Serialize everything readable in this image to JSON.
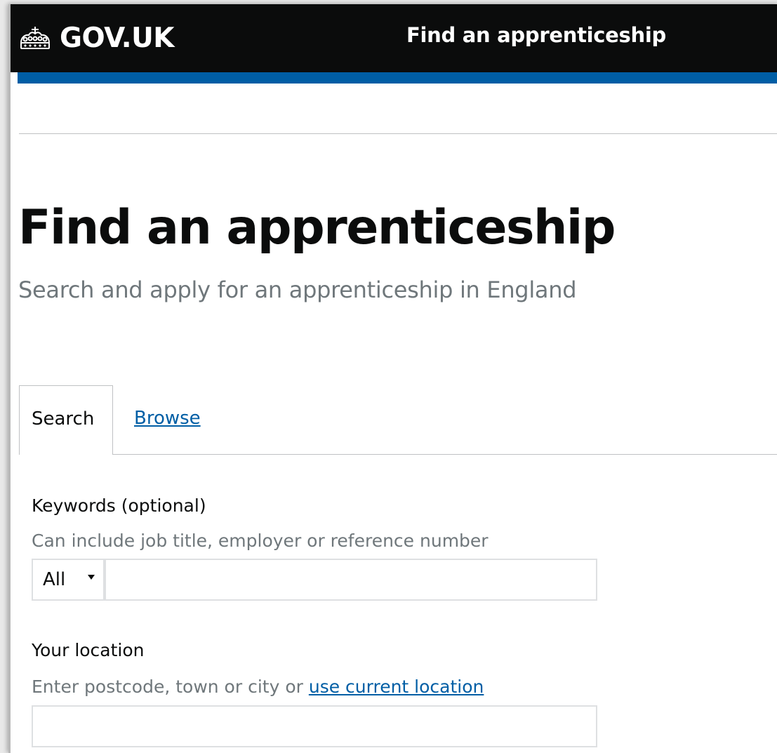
{
  "header": {
    "logo_text": "GOV.UK",
    "logo_icon": "crown-icon",
    "service_name": "Find an apprenticeship",
    "colors": {
      "header_bg": "#0b0c0c",
      "accent_bar": "#005ea5"
    }
  },
  "main": {
    "title": "Find an apprenticeship",
    "subtitle": "Search and apply for an apprenticeship in England"
  },
  "tabs": [
    {
      "label": "Search",
      "active": true
    },
    {
      "label": "Browse",
      "active": false
    }
  ],
  "form": {
    "keywords": {
      "label": "Keywords (optional)",
      "hint": "Can include job title, employer or reference number",
      "category_selected": "All",
      "value": ""
    },
    "location": {
      "label": "Your location",
      "hint": "Enter postcode, town or city or",
      "hint_link": "use current location",
      "value": ""
    }
  },
  "colors": {
    "link": "#005ea5",
    "secondary_text": "#6f777b",
    "border": "#bfc1c3"
  }
}
